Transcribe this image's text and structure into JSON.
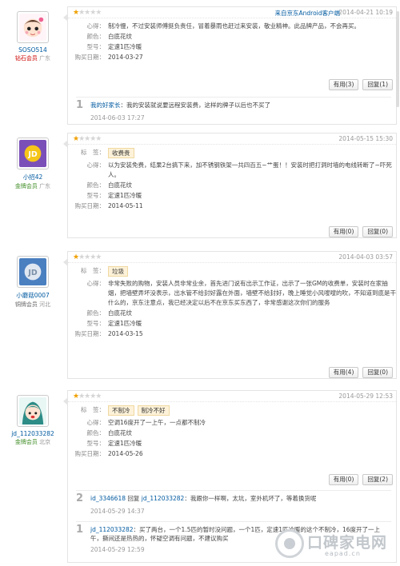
{
  "reviews": [
    {
      "user": {
        "name": "SOSO514",
        "level": "钻石会员",
        "region": "广东"
      },
      "stars": 1,
      "source": "来自京东Android客户端",
      "date": "2014-04-21 10:19",
      "rows": [
        {
          "k": "心得：",
          "v": "制冷慢，不过安装师傅挺负责任，冒着暴雨也赶过来安装，敬业精神。此品牌产品，不会再买。"
        },
        {
          "k": "颜色：",
          "v": "白底花纹"
        },
        {
          "k": "型号：",
          "v": "定速1匹冷暖"
        },
        {
          "k": "购买日期：",
          "v": "2014-03-27"
        }
      ],
      "useful": "有用(3)",
      "reply": "回复(1)",
      "replies": [
        {
          "num": "1",
          "who": "我的好家长",
          "text": "：我的安装就说要远程安装费，这样的牌子以后也不买了",
          "date": "2014-06-03 17:27"
        }
      ]
    },
    {
      "user": {
        "name": "小招42",
        "level": "金牌会员",
        "region": "广东"
      },
      "stars": 1,
      "date": "2014-05-15 15:30",
      "tags_label": "标　签：",
      "tags": [
        "收费贵"
      ],
      "rows": [
        {
          "k": "心得：",
          "v": "以为安装免费，结果2台搞下来，加不锈钢铁架一共四百五~艹蛋！！安装时把打洞时墙的电线转断了~吓死人。"
        },
        {
          "k": "颜色：",
          "v": "白底花纹"
        },
        {
          "k": "型号：",
          "v": "定速1匹冷暖"
        },
        {
          "k": "购买日期：",
          "v": "2014-05-11"
        }
      ],
      "useful": "有用(0)",
      "reply": "回复(0)"
    },
    {
      "user": {
        "name": "小蘑菇0007",
        "level": "铜牌会员",
        "region": "河北"
      },
      "stars": 1,
      "date": "2014-04-03 03:57",
      "tags_label": "标　签：",
      "tags": [
        "垃圾"
      ],
      "rows": [
        {
          "k": "心得：",
          "v": "非常失败的购物，安装人员非常业余，首先进门说有出示工作证，出示了一张GM的收费单，安装时在家抽烟，把墙壁弄坏没表示，出水管不给封好露在外面，墙壁不给封好，晚上睡觉小风嗖嗖的吹，不知道到底是干什么的，京东注意点，我已经决定以后不在京东买东西了，非常感谢这次你们的服务"
        },
        {
          "k": "颜色：",
          "v": "白底花纹"
        },
        {
          "k": "型号：",
          "v": "定速1匹冷暖"
        },
        {
          "k": "购买日期：",
          "v": "2014-03-15"
        }
      ],
      "useful": "有用(4)",
      "reply": "回复(0)"
    },
    {
      "user": {
        "name": "jd_112033282",
        "level": "金牌会员",
        "region": "北京"
      },
      "stars": 1,
      "date": "2014-05-29 12:53",
      "tags_label": "标　签：",
      "tags": [
        "不制冷",
        "制冷不好"
      ],
      "rows": [
        {
          "k": "心得：",
          "v": "空调16度开了一上午，一点都不制冷"
        },
        {
          "k": "颜色：",
          "v": "白底花纹"
        },
        {
          "k": "型号：",
          "v": "定速1匹冷暖"
        },
        {
          "k": "购买日期：",
          "v": "2014-05-26"
        }
      ],
      "useful": "有用(0)",
      "reply": "回复(2)",
      "replies": [
        {
          "num": "2",
          "who": "id_3346618",
          "mid": "回复",
          "to": "jd_112033282",
          "text": "：我跟你一样啊，太坑，室外机坏了，等着换货呢",
          "date": "2014-05-29 14:37"
        },
        {
          "num": "1",
          "who": "jd_112033282",
          "text": "：买了两台，一个1.5匹的暂时没问题，一个1匹，定速1匹冷暖的这个不制冷，16度开了一上午，撕间还是热热的，怀疑空调有问题，不建议购买",
          "date": "2014-05-29 12:59"
        }
      ]
    }
  ],
  "watermark": {
    "title": "口碑家电网",
    "url": "eapad.cn"
  }
}
